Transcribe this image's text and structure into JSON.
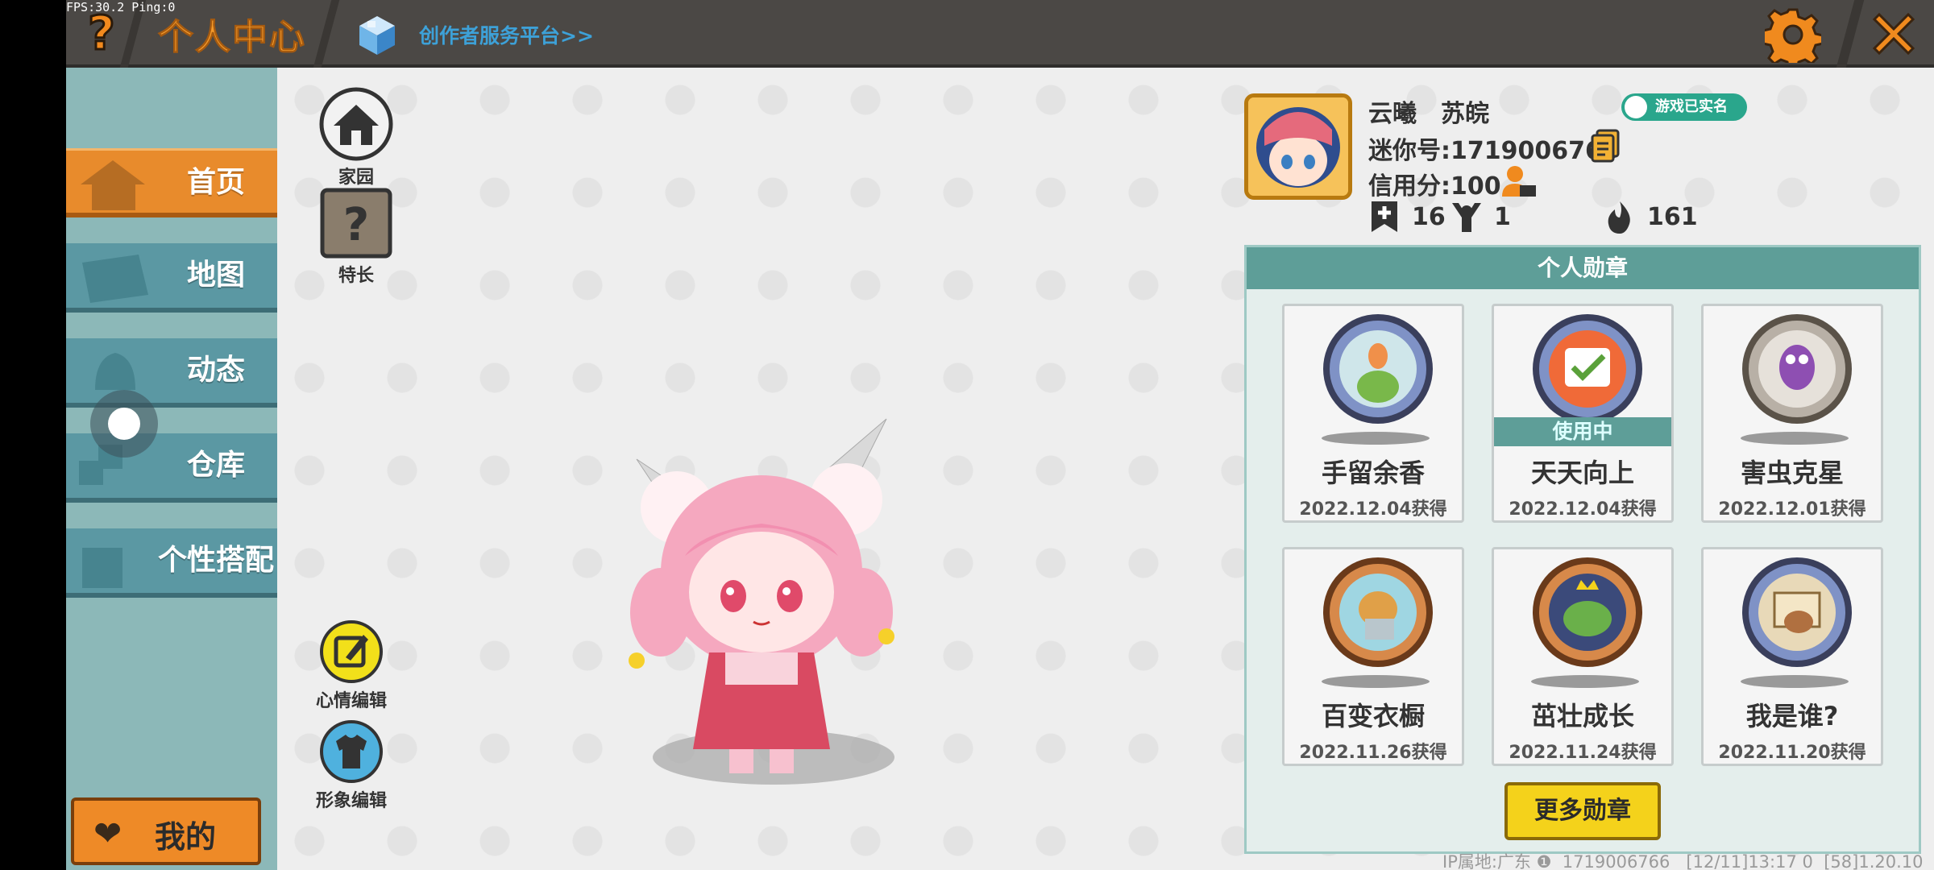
{
  "debug": {
    "fps_text": "FPS:30.2  Ping:0"
  },
  "header": {
    "title": "个人中心",
    "creator_link": "创作者服务平台>>",
    "help_icon": "question-icon",
    "settings_icon": "gear-icon",
    "close_icon": "close-icon"
  },
  "sidebar": {
    "items": [
      {
        "label": "首页",
        "icon": "home-icon",
        "active": true
      },
      {
        "label": "地图",
        "icon": "map-icon",
        "active": false
      },
      {
        "label": "动态",
        "icon": "bell-icon",
        "active": false
      },
      {
        "label": "仓库",
        "icon": "box-icon",
        "active": false
      },
      {
        "label": "个性搭配",
        "icon": "outfit-icon",
        "active": false
      }
    ],
    "mine_label": "我的"
  },
  "quick_icons": {
    "home": "家园",
    "skill": "特长",
    "mood_edit": "心情编辑",
    "avatar_edit": "形象编辑"
  },
  "profile": {
    "name": "云曦　苏皖",
    "mini_id": "迷你号:1719006766",
    "credit": "信用分:100",
    "realname_badge": "游戏已实名",
    "stats": {
      "add": "16",
      "fans": "1",
      "heat": "161"
    }
  },
  "medals": {
    "title": "个人勋章",
    "items": [
      {
        "name": "手留余香",
        "date": "2022.12.04获得",
        "in_use": false,
        "color": "#7f92c6"
      },
      {
        "name": "天天向上",
        "date": "2022.12.04获得",
        "in_use": true,
        "color": "#7f92c6"
      },
      {
        "name": "害虫克星",
        "date": "2022.12.01获得",
        "in_use": false,
        "color": "#b8b0a6"
      },
      {
        "name": "百变衣橱",
        "date": "2022.11.26获得",
        "in_use": false,
        "color": "#d7894a"
      },
      {
        "name": "茁壮成长",
        "date": "2022.11.24获得",
        "in_use": false,
        "color": "#d7894a"
      },
      {
        "name": "我是谁?",
        "date": "2022.11.20获得",
        "in_use": false,
        "color": "#7f92c6"
      }
    ],
    "in_use_label": "使用中",
    "more_label": "更多勋章"
  },
  "footer": {
    "info": "IP属地:广东 ❶  1719006766   [12/11]13:17 0  [58]1.20.10"
  },
  "colors": {
    "accent_orange": "#e88b2c",
    "teal": "#5e9e98",
    "yellow": "#f4d21b"
  }
}
